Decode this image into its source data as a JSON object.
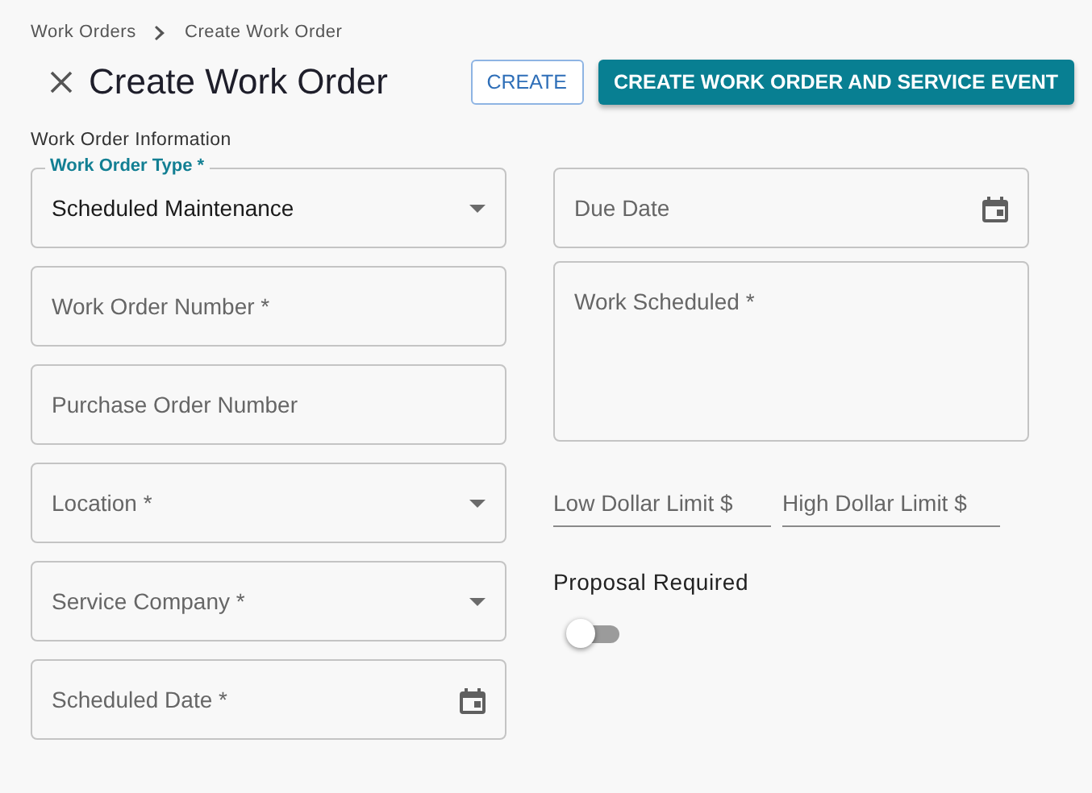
{
  "breadcrumb": [
    "Work Orders",
    "Create Work Order"
  ],
  "title": "Create Work Order",
  "buttons": [
    {
      "label": "CREATE",
      "kind": "outlined"
    },
    {
      "label": "CREATE WORK ORDER AND SERVICE EVENT",
      "kind": "filled"
    }
  ],
  "section_label": "Work Order Information",
  "left_fields": [
    {
      "kind": "select",
      "label": "Work Order Type *",
      "value": "Scheduled Maintenance"
    },
    {
      "kind": "text",
      "label": "Work Order Number *"
    },
    {
      "kind": "text",
      "label": "Purchase Order Number"
    },
    {
      "kind": "select",
      "label": "Location *"
    },
    {
      "kind": "select",
      "label": "Service Company *"
    },
    {
      "kind": "date",
      "label": "Scheduled Date *"
    }
  ],
  "right_fields": [
    {
      "kind": "date",
      "label": "Due Date"
    },
    {
      "kind": "textarea",
      "label": "Work Scheduled *"
    }
  ],
  "limit_fields": [
    "Low Dollar Limit $",
    "High Dollar Limit $"
  ],
  "proposal": {
    "label": "Proposal Required",
    "on": false
  }
}
